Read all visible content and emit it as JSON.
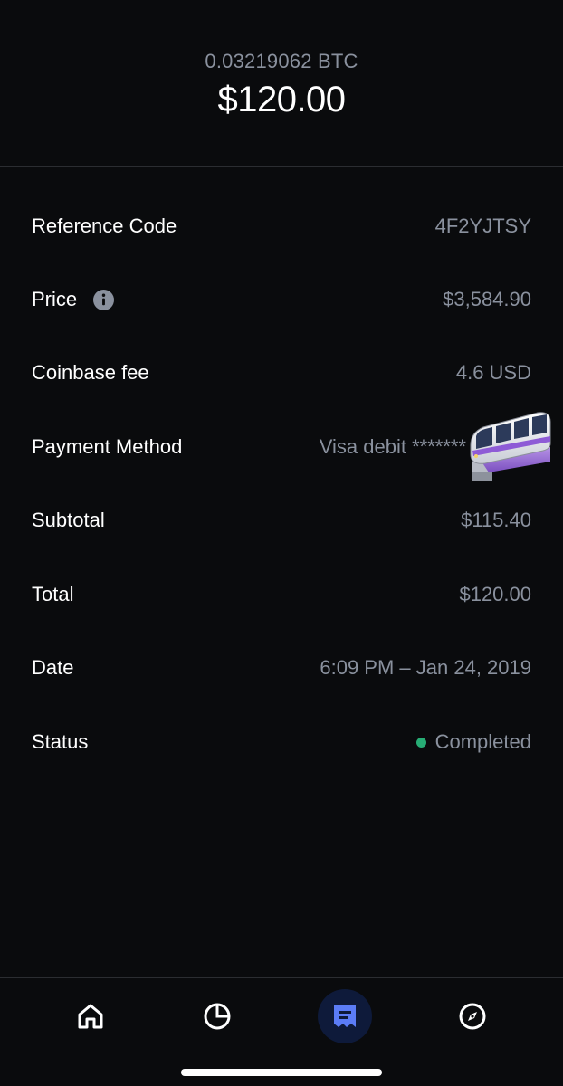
{
  "transaction": {
    "crypto_amount": "0.03219062 BTC",
    "fiat_amount": "$120.00"
  },
  "details": [
    {
      "label": "Reference Code",
      "value": "4F2YJTSY"
    },
    {
      "label": "Price",
      "value": "$3,584.90",
      "icon": "info-icon"
    },
    {
      "label": "Coinbase fee",
      "value": "4.6 USD"
    },
    {
      "label": "Payment Method",
      "value": "Visa debit *******"
    },
    {
      "label": "Subtotal",
      "value": "$115.40"
    },
    {
      "label": "Total",
      "value": "$120.00"
    },
    {
      "label": "Date",
      "value": "6:09 PM – Jan 24, 2019"
    },
    {
      "label": "Status",
      "value": "Completed",
      "status_color": "#27ad75"
    }
  ],
  "overlay_emoji": "monorail",
  "tabbar": {
    "tabs": [
      {
        "name": "home",
        "icon": "home-icon"
      },
      {
        "name": "portfolio",
        "icon": "pie-chart-icon"
      },
      {
        "name": "transactions",
        "icon": "receipt-icon",
        "active": true
      },
      {
        "name": "explore",
        "icon": "compass-icon"
      }
    ],
    "active_color": "#5b7cf6",
    "active_bg": "#0e1a3a"
  }
}
